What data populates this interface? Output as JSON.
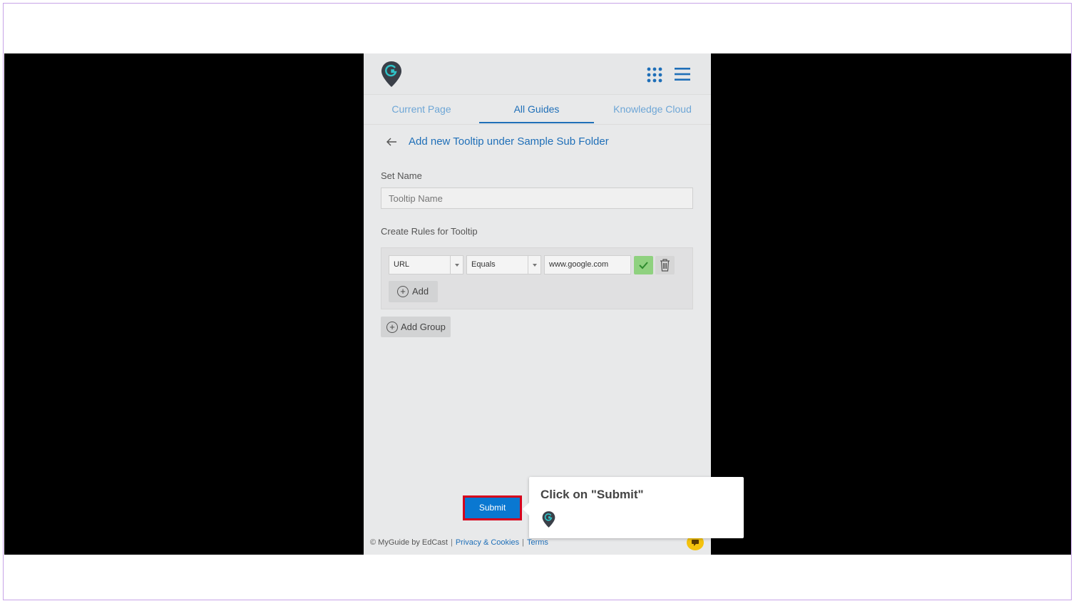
{
  "header": {
    "logo_icon": "myguide-pin-logo-icon",
    "apps_icon": "grid-apps-icon",
    "menu_icon": "hamburger-menu-icon"
  },
  "tabs": [
    {
      "label": "Current Page",
      "active": false
    },
    {
      "label": "All Guides",
      "active": true
    },
    {
      "label": "Knowledge Cloud",
      "active": false
    }
  ],
  "form": {
    "title": "Add new Tooltip under Sample Sub Folder",
    "set_name_label": "Set Name",
    "name_placeholder": "Tooltip Name",
    "rules_label": "Create Rules for Tooltip",
    "rule": {
      "field": "URL",
      "operator": "Equals",
      "value": "www.google.com"
    },
    "add_label": "Add",
    "add_group_label": "Add Group",
    "submit_label": "Submit"
  },
  "footer": {
    "brand": "© MyGuide by EdCast",
    "privacy": "Privacy & Cookies",
    "terms": "Terms"
  },
  "tooltip": {
    "text": "Click on \"Submit\""
  },
  "colors": {
    "accent": "#1f6fb8",
    "submit_bg": "#0a78d1",
    "highlight_border": "#d6001c",
    "check_green": "#8fd17f",
    "chat_yellow": "#f4c20d"
  }
}
